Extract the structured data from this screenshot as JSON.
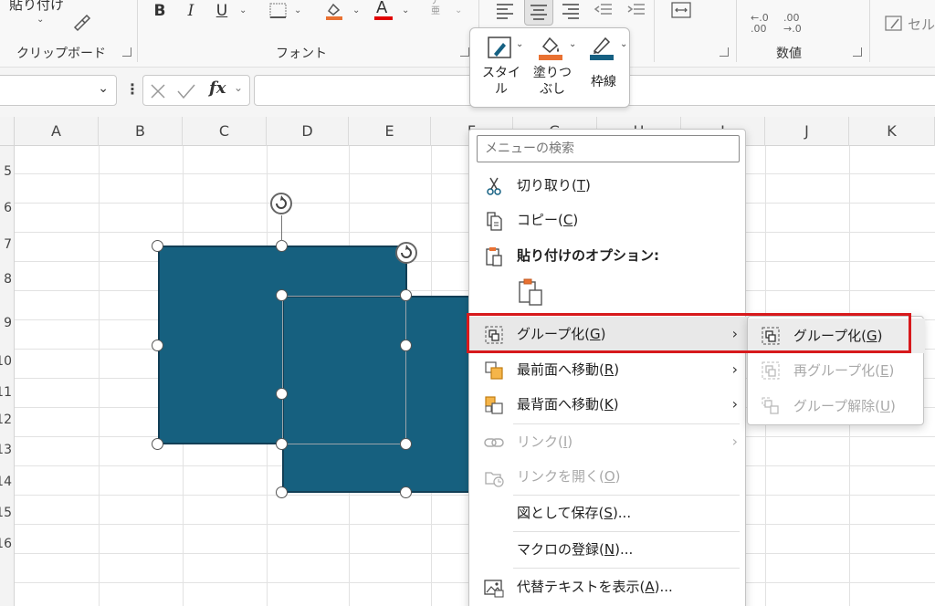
{
  "ribbon": {
    "paste_label": "貼り付け",
    "clipboard_label": "クリップボード",
    "font_label": "フォント",
    "number_label": "数値",
    "cells_label": "セル",
    "bold": "B",
    "italic": "I",
    "underline": "U",
    "font_color_glyph": "A",
    "phonetic_glyph": "ア亜",
    "dec_increase": "←.0\n.00",
    "dec_decrease": ".00\n→.0",
    "fill_color": "#e97132",
    "font_color": "#e00000"
  },
  "formula_bar": {
    "fx": "fx",
    "value": ""
  },
  "columns": [
    "A",
    "B",
    "C",
    "D",
    "E",
    "F",
    "G",
    "H",
    "I",
    "J",
    "K"
  ],
  "rows": [
    "5",
    "6",
    "7",
    "8",
    "9",
    "10",
    "11",
    "12",
    "13",
    "14",
    "15",
    "16"
  ],
  "mini_toolbar": {
    "style_label": "スタイ\nル",
    "fill_label": "塗りつ\nぶし",
    "outline_label": "枠線",
    "fill_color": "#e97132",
    "outline_color": "#156082"
  },
  "context_menu": {
    "search_placeholder": "メニューの検索",
    "cut": {
      "text": "切り取り(",
      "key": "T",
      "end": ")"
    },
    "copy": {
      "text": "コピー(",
      "key": "C",
      "end": ")"
    },
    "paste_options": "貼り付けのオプション:",
    "group": {
      "text": "グループ化(",
      "key": "G",
      "end": ")"
    },
    "bring_front": {
      "text": "最前面へ移動(",
      "key": "R",
      "end": ")"
    },
    "send_back": {
      "text": "最背面へ移動(",
      "key": "K",
      "end": ")"
    },
    "link": {
      "text": "リンク(",
      "key": "I",
      "end": ")"
    },
    "open_link": {
      "text": "リンクを開く(",
      "key": "O",
      "end": ")"
    },
    "save_as_picture": {
      "text": "図として保存(",
      "key": "S",
      "end": ")..."
    },
    "assign_macro": {
      "text": "マクロの登録(",
      "key": "N",
      "end": ")..."
    },
    "alt_text": {
      "text": "代替テキストを表示(",
      "key": "A",
      "end": ")..."
    },
    "arrow": "›"
  },
  "submenu": {
    "group": {
      "text": "グループ化(",
      "key": "G",
      "end": ")"
    },
    "regroup": {
      "text": "再グループ化(",
      "key": "E",
      "end": ")"
    },
    "ungroup": {
      "text": "グループ解除(",
      "key": "U",
      "end": ")"
    }
  },
  "colors": {
    "shape_fill": "#16607f",
    "highlight": "#d7191c"
  }
}
